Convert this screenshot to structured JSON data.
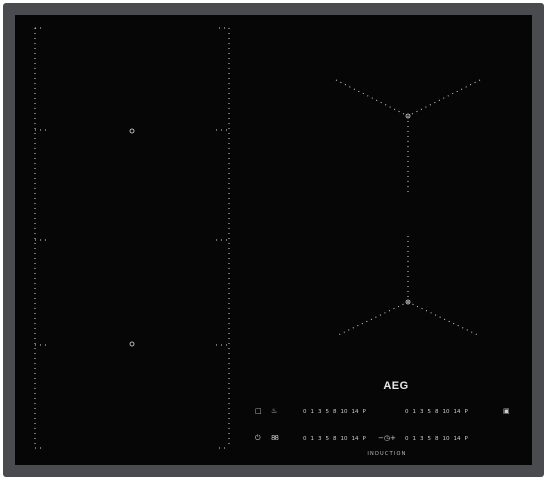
{
  "product": {
    "brand": "AEG",
    "label": "INDUCTION"
  },
  "controls": {
    "power_scale": [
      "0",
      "1",
      "3",
      "5",
      "8",
      "10",
      "14",
      "P"
    ],
    "icons": {
      "lock": "lock-icon",
      "bridge": "chef-hat-icon",
      "power": "power-icon",
      "timer_display": "display-icon",
      "minus_plus": "minus-plus-icon",
      "stopgo": "stop-go-icon"
    }
  },
  "colors": {
    "glass": "#060606",
    "frame": "#4a4b4e",
    "markings": "#d0d0d0"
  }
}
